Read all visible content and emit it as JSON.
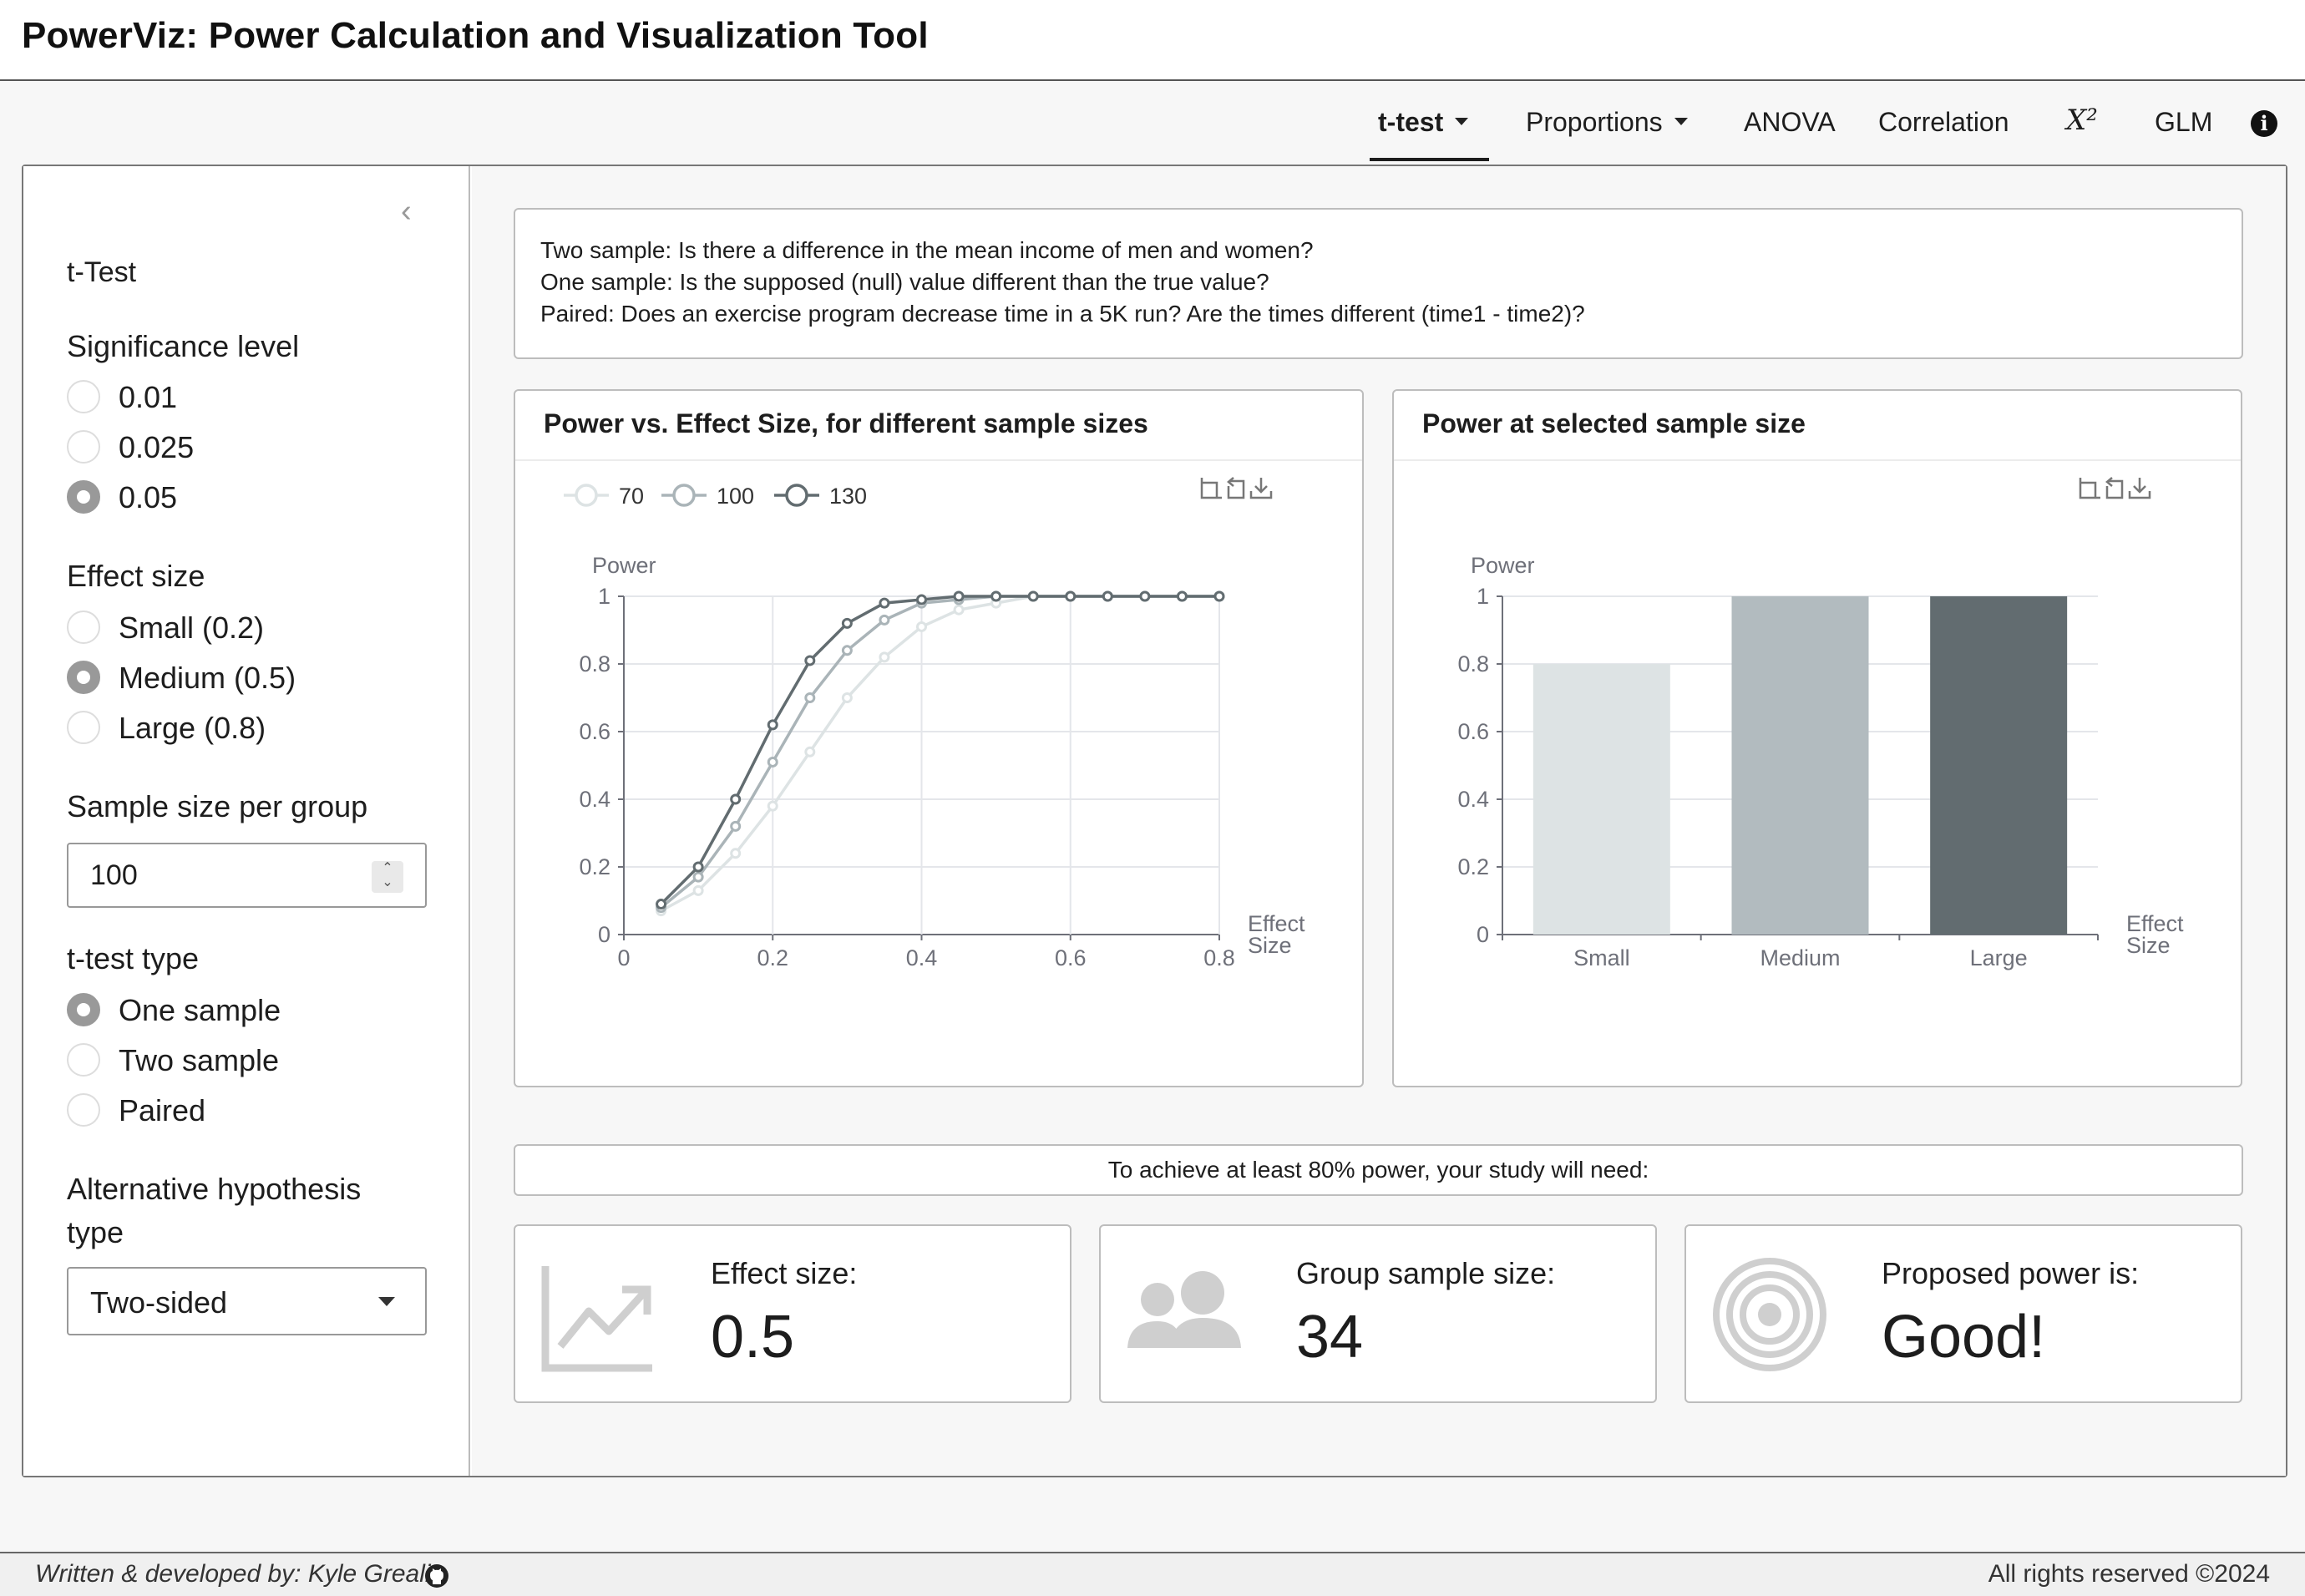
{
  "app": {
    "title": "PowerViz: Power Calculation and Visualization Tool"
  },
  "nav": {
    "items": [
      {
        "label": "t-test",
        "dropdown": true,
        "active": true
      },
      {
        "label": "Proportions",
        "dropdown": true
      },
      {
        "label": "ANOVA"
      },
      {
        "label": "Correlation"
      },
      {
        "label": "X²"
      },
      {
        "label": "GLM"
      }
    ],
    "info_icon": "info-circle-icon"
  },
  "sidebar": {
    "heading": "t-Test",
    "collapse_icon": "chevron-left-icon",
    "significance": {
      "label": "Significance level",
      "options": [
        "0.01",
        "0.025",
        "0.05"
      ],
      "selected": "0.05"
    },
    "effect": {
      "label": "Effect size",
      "options": [
        "Small (0.2)",
        "Medium (0.5)",
        "Large (0.8)"
      ],
      "selected": "Medium (0.5)"
    },
    "sample": {
      "label": "Sample size per group",
      "value": "100"
    },
    "ttype": {
      "label": "t-test type",
      "options": [
        "One sample",
        "Two sample",
        "Paired"
      ],
      "selected": "One sample"
    },
    "alt": {
      "label_line1": "Alternative hypothesis",
      "label_line2": "type",
      "value": "Two-sided"
    }
  },
  "description": {
    "lines": [
      "Two sample: Is there a difference in the mean income of men and women?",
      "One sample: Is the supposed (null) value different than the true value?",
      "Paired: Does an exercise program decrease time in a 5K run? Are the times different (time1 - time2)?"
    ]
  },
  "line_card": {
    "title": "Power vs. Effect Size, for different sample sizes"
  },
  "bar_card": {
    "title": "Power at selected sample size"
  },
  "chart_data": [
    {
      "type": "line",
      "ylabel": "Power",
      "xlabel": "Effect Size",
      "xlim": [
        0,
        0.8
      ],
      "ylim": [
        0,
        1
      ],
      "xticks": [
        "0",
        "0.2",
        "0.4",
        "0.6",
        "0.8"
      ],
      "yticks": [
        "0",
        "0.2",
        "0.4",
        "0.6",
        "0.8",
        "1"
      ],
      "x": [
        0.05,
        0.1,
        0.15,
        0.2,
        0.25,
        0.3,
        0.35,
        0.4,
        0.45,
        0.5,
        0.55,
        0.6,
        0.65,
        0.7,
        0.75,
        0.8
      ],
      "legend": "top-left",
      "series": [
        {
          "name": "70",
          "color": "#dde3e4",
          "values": [
            0.07,
            0.13,
            0.24,
            0.38,
            0.54,
            0.7,
            0.82,
            0.91,
            0.96,
            0.98,
            1,
            1,
            1,
            1,
            1,
            1
          ]
        },
        {
          "name": "100",
          "color": "#aab4b8",
          "values": [
            0.08,
            0.17,
            0.32,
            0.51,
            0.7,
            0.84,
            0.93,
            0.98,
            0.99,
            1,
            1,
            1,
            1,
            1,
            1,
            1
          ]
        },
        {
          "name": "130",
          "color": "#626c70",
          "values": [
            0.09,
            0.2,
            0.4,
            0.62,
            0.81,
            0.92,
            0.98,
            0.99,
            1,
            1,
            1,
            1,
            1,
            1,
            1,
            1
          ]
        }
      ],
      "toolbar": [
        "zoom-icon",
        "reset-icon",
        "download-icon"
      ]
    },
    {
      "type": "bar",
      "ylabel": "Power",
      "xlabel": "Effect Size",
      "ylim": [
        0,
        1
      ],
      "yticks": [
        "0",
        "0.2",
        "0.4",
        "0.6",
        "0.8",
        "1"
      ],
      "categories": [
        "Small",
        "Medium",
        "Large"
      ],
      "values": [
        0.8,
        1,
        1
      ],
      "colors": [
        "#dde3e4",
        "#b2bbbf",
        "#626c70"
      ],
      "toolbar": [
        "zoom-icon",
        "reset-icon",
        "download-icon"
      ]
    }
  ],
  "need_banner": "To achieve at least 80% power, your study will need:",
  "value_boxes": [
    {
      "label": "Effect size:",
      "value": "0.5",
      "icon": "chart-line-icon"
    },
    {
      "label": "Group sample size:",
      "value": "34",
      "icon": "users-icon"
    },
    {
      "label": "Proposed power is:",
      "value": "Good!",
      "icon": "bullseye-icon"
    }
  ],
  "footer": {
    "left": "Written & developed by: Kyle Grealis",
    "right": "All rights reserved ©2024",
    "github_icon": "github-icon"
  }
}
